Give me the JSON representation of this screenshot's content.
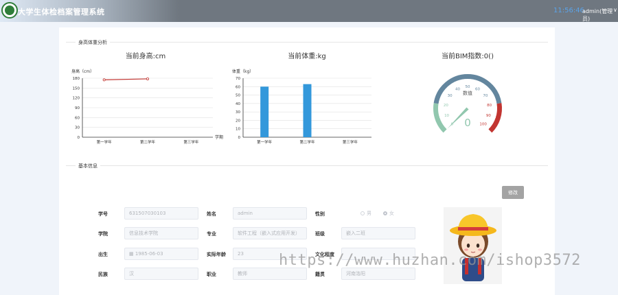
{
  "header": {
    "app_title": "大学生体检档案管理系统",
    "clock": "11:56:46",
    "user": "admin(管理员)",
    "caret": "∨"
  },
  "section_body": {
    "title": "身高体重分析"
  },
  "section_info": {
    "title": "基本信息"
  },
  "height_chart": {
    "title": "当前身高:cm",
    "ylabel": "身高（cm）",
    "xlabel": "学期"
  },
  "weight_chart": {
    "title": "当前体重:kg",
    "ylabel": "体重（kg）"
  },
  "gauge": {
    "title": "当前BIM指数:0()",
    "label": "数值",
    "value": 0,
    "value_text": "0",
    "ticks": [
      "0",
      "10",
      "20",
      "30",
      "40",
      "50",
      "60",
      "70",
      "80",
      "90",
      "100"
    ]
  },
  "chart_data": [
    {
      "type": "line",
      "title": "当前身高:cm",
      "ylabel": "身高（cm）",
      "xlabel": "学期",
      "categories": [
        "第一学年",
        "第二学年",
        "第三学年"
      ],
      "values": [
        175,
        178,
        null
      ],
      "ylim": [
        0,
        180
      ],
      "yticks": [
        0,
        30,
        60,
        90,
        120,
        150,
        180
      ],
      "color": "#c23531"
    },
    {
      "type": "bar",
      "title": "当前体重:kg",
      "ylabel": "体重（kg）",
      "categories": [
        "第一学年",
        "第二学年",
        "第三学年"
      ],
      "values": [
        60,
        63,
        null
      ],
      "ylim": [
        0,
        70
      ],
      "yticks": [
        0,
        10,
        20,
        30,
        40,
        50,
        60,
        70
      ],
      "color": "#3398db"
    }
  ],
  "form": {
    "edit_button": "修改",
    "labels": {
      "student_id": "学号",
      "name": "姓名",
      "gender": "性别",
      "college": "学院",
      "major": "专业",
      "class": "班级",
      "birth": "出生",
      "age": "实际年龄",
      "education": "文化程度",
      "ethnicity": "民族",
      "occupation": "职业",
      "native_place": "籍贯"
    },
    "values": {
      "student_id": "631507030103",
      "name": "admin",
      "college": "信息技术学院",
      "major": "软件工程（嵌入式应用开发）",
      "class": "嵌入二班",
      "birth": "1985-06-03",
      "age": "23",
      "education": "",
      "ethnicity": "汉",
      "occupation": "教师",
      "native_place": "河南洛阳"
    },
    "gender_options": [
      "男",
      "女"
    ],
    "gender_selected": "女",
    "calendar_icon": "calendar-icon"
  },
  "watermark": "https://www.huzhan.com/ishop3572"
}
